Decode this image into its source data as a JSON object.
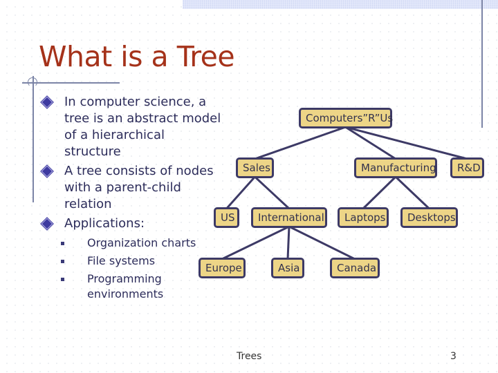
{
  "slide": {
    "title": "What is a Tree",
    "bullets": [
      "In computer science, a tree is an abstract model of a hierarchical structure",
      "A tree consists of nodes with a parent-child relation",
      "Applications:"
    ],
    "sub_bullets": [
      "Organization charts",
      "File systems",
      "Programming environments"
    ],
    "footer": {
      "title": "Trees",
      "page_number": "3"
    }
  },
  "tree": {
    "nodes": {
      "root": "Computers”R”Us",
      "sales": "Sales",
      "manufacturing": "Manufacturing",
      "rnd": "R&D",
      "us": "US",
      "international": "International",
      "laptops": "Laptops",
      "desktops": "Desktops",
      "europe": "Europe",
      "asia": "Asia",
      "canada": "Canada"
    },
    "edges": [
      [
        "root",
        "sales"
      ],
      [
        "root",
        "manufacturing"
      ],
      [
        "root",
        "rnd"
      ],
      [
        "sales",
        "us"
      ],
      [
        "sales",
        "international"
      ],
      [
        "manufacturing",
        "laptops"
      ],
      [
        "manufacturing",
        "desktops"
      ],
      [
        "international",
        "europe"
      ],
      [
        "international",
        "asia"
      ],
      [
        "international",
        "canada"
      ]
    ]
  },
  "colors": {
    "title": "#a5321a",
    "body_text": "#2c2c5a",
    "node_fill": "#edd587",
    "node_border": "#3d3a66",
    "edge": "#3d3a66",
    "rule": "#7b84a6"
  }
}
